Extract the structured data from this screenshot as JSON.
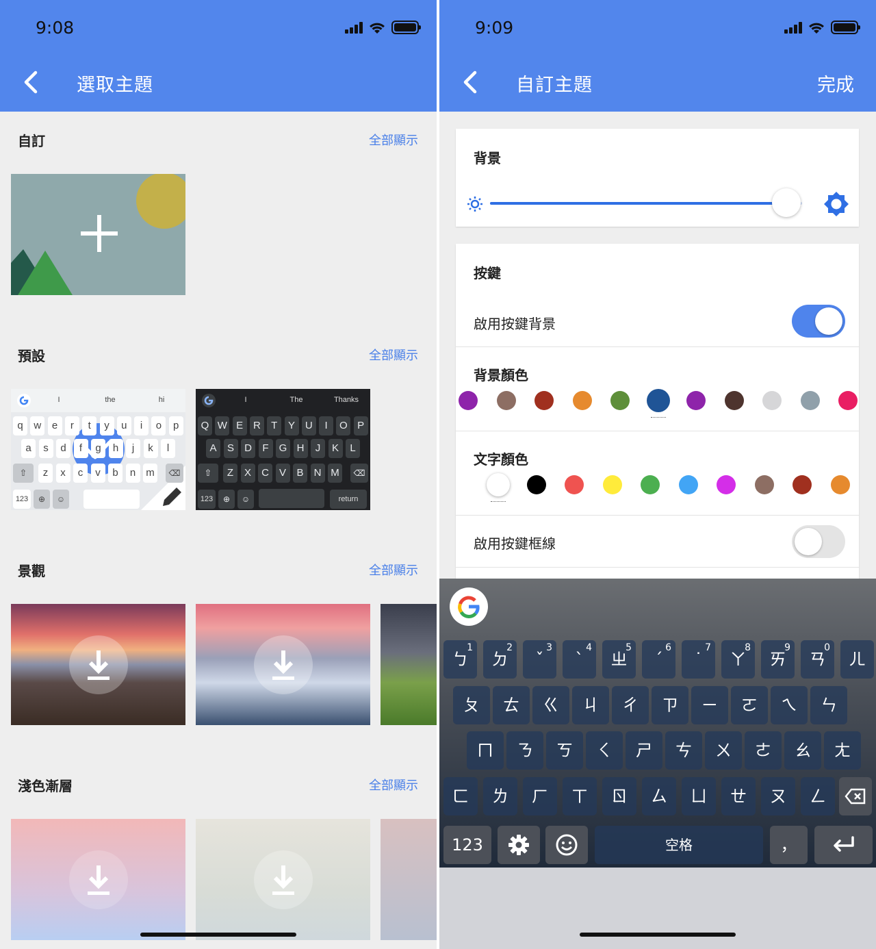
{
  "left": {
    "status": {
      "time": "9:08"
    },
    "appbar": {
      "title": "選取主題"
    },
    "sections": [
      {
        "title": "自訂",
        "show_all": "全部顯示"
      },
      {
        "title": "預設",
        "show_all": "全部顯示"
      },
      {
        "title": "景觀",
        "show_all": "全部顯示"
      },
      {
        "title": "淺色漸層",
        "show_all": "全部顯示"
      }
    ],
    "light_kb": {
      "suggestions": [
        "I",
        "the",
        "hi"
      ],
      "row1": [
        "q",
        "w",
        "e",
        "r",
        "t",
        "y",
        "u",
        "i",
        "o",
        "p"
      ],
      "row2": [
        "a",
        "s",
        "d",
        "f",
        "g",
        "h",
        "j",
        "k",
        "l"
      ],
      "row3": [
        "z",
        "x",
        "c",
        "v",
        "b",
        "n",
        "m"
      ],
      "num": "123"
    },
    "dark_kb": {
      "suggestions": [
        "I",
        "The",
        "Thanks"
      ],
      "row1": [
        "Q",
        "W",
        "E",
        "R",
        "T",
        "Y",
        "U",
        "I",
        "O",
        "P"
      ],
      "row2": [
        "A",
        "S",
        "D",
        "F",
        "G",
        "H",
        "J",
        "K",
        "L"
      ],
      "row3": [
        "Z",
        "X",
        "C",
        "V",
        "B",
        "N",
        "M"
      ],
      "num": "123",
      "return": "return"
    }
  },
  "right": {
    "status": {
      "time": "9:09"
    },
    "appbar": {
      "title": "自訂主題",
      "done": "完成"
    },
    "background_card": {
      "title": "背景",
      "brightness": 0.95
    },
    "keys_card": {
      "title": "按鍵",
      "enable_key_bg": "啟用按鍵背景",
      "enable_key_bg_on": true,
      "bg_color_label": "背景顏色",
      "bg_colors": [
        "#8e24aa",
        "#8d6e63",
        "#a0301f",
        "#e68a2e",
        "#5e8f3a",
        "#1f5496",
        "#8e24aa",
        "#4e342e",
        "#d6d6d8",
        "#90a0aa",
        "#e91e63"
      ],
      "bg_color_selected": 5,
      "text_color_label": "文字顏色",
      "text_colors": [
        "#ffffff",
        "#000000",
        "#ef5350",
        "#ffeb3b",
        "#4caf50",
        "#42a5f5",
        "#d42ee8",
        "#8d6e63",
        "#a0301f",
        "#e68a2e"
      ],
      "text_color_selected": 0,
      "enable_key_border": "啟用按鍵框線",
      "enable_key_border_on": false
    },
    "keyboard": {
      "row1": [
        [
          "ㄅ",
          "1"
        ],
        [
          "ㄉ",
          "2"
        ],
        [
          "ˇ",
          "3"
        ],
        [
          "ˋ",
          "4"
        ],
        [
          "ㄓ",
          "5"
        ],
        [
          "ˊ",
          "6"
        ],
        [
          "˙",
          "7"
        ],
        [
          "ㄚ",
          "8"
        ],
        [
          "ㄞ",
          "9"
        ],
        [
          "ㄢ",
          "0"
        ],
        [
          "ㄦ",
          ""
        ]
      ],
      "row2": [
        "ㄆ",
        "ㄊ",
        "ㄍ",
        "ㄐ",
        "ㄔ",
        "ㄗ",
        "ㄧ",
        "ㄛ",
        "ㄟ",
        "ㄣ"
      ],
      "row3": [
        "ㄇ",
        "ㄋ",
        "ㄎ",
        "ㄑ",
        "ㄕ",
        "ㄘ",
        "ㄨ",
        "ㄜ",
        "ㄠ",
        "ㄤ"
      ],
      "row4": [
        "ㄈ",
        "ㄌ",
        "ㄏ",
        "ㄒ",
        "ㄖ",
        "ㄙ",
        "ㄩ",
        "ㄝ",
        "ㄡ",
        "ㄥ"
      ],
      "num": "123",
      "space": "空格",
      "comma": "，"
    }
  }
}
